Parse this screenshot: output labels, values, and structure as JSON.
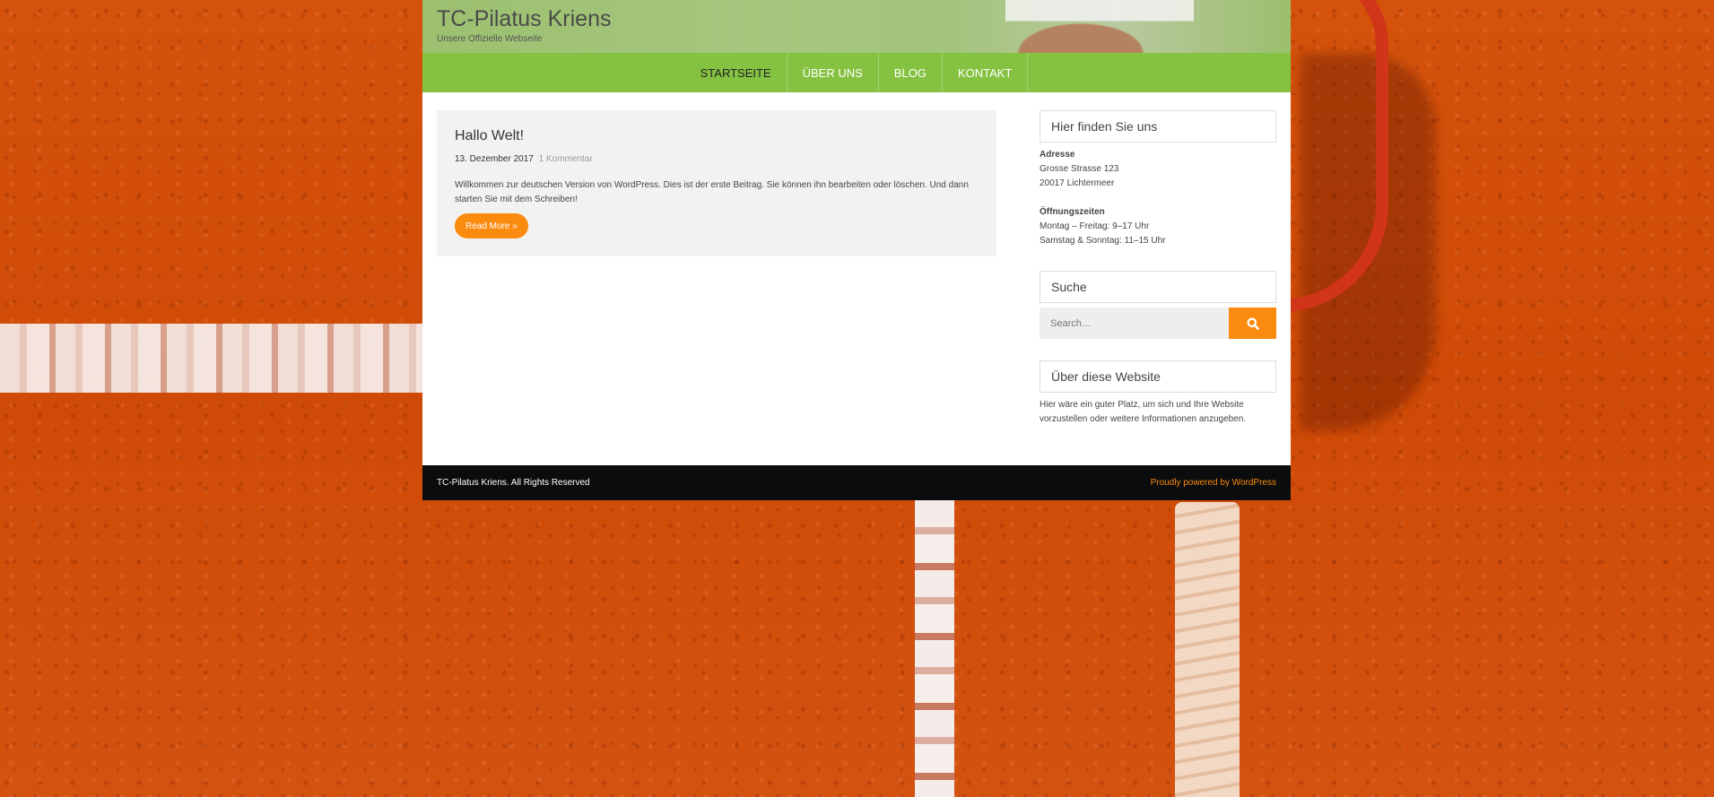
{
  "header": {
    "title": "TC-Pilatus Kriens",
    "description": "Unsere Offizielle Webseite"
  },
  "nav": {
    "items": [
      {
        "label": "STARTSEITE",
        "active": true
      },
      {
        "label": "ÜBER UNS",
        "active": false
      },
      {
        "label": "BLOG",
        "active": false
      },
      {
        "label": "KONTAKT",
        "active": false
      }
    ]
  },
  "post": {
    "title": "Hallo Welt!",
    "date": "13. Dezember 2017",
    "comments": "1 Kommentar",
    "excerpt": "Willkommen zur deutschen Version von WordPress. Dies ist der erste Beitrag. Sie können ihn bearbeiten oder löschen. Und dann starten Sie mit dem Schreiben!",
    "read_more": "Read More »"
  },
  "sidebar": {
    "find_us": {
      "title": "Hier finden Sie uns",
      "address_label": "Adresse",
      "address_line1": "Grosse Strasse 123",
      "address_line2": "20017 Lichtermeer",
      "hours_label": "Öffnungszeiten",
      "hours_line1": "Montag – Freitag: 9–17 Uhr",
      "hours_line2": "Samstag & Sonntag: 11–15 Uhr"
    },
    "search": {
      "title": "Suche",
      "placeholder": "Search…"
    },
    "about": {
      "title": "Über diese Website",
      "text": "Hier wäre ein guter Platz, um sich und Ihre Website vorzustellen oder weitere Informationen anzugeben."
    }
  },
  "footer": {
    "copyright": "TC-Pilatus Kriens. All Rights Reserved",
    "powered": "Proudly powered by WordPress"
  },
  "colors": {
    "nav_green": "#85c242",
    "accent_orange": "#fb8b0f",
    "footer_dark": "#0b0c0d"
  }
}
